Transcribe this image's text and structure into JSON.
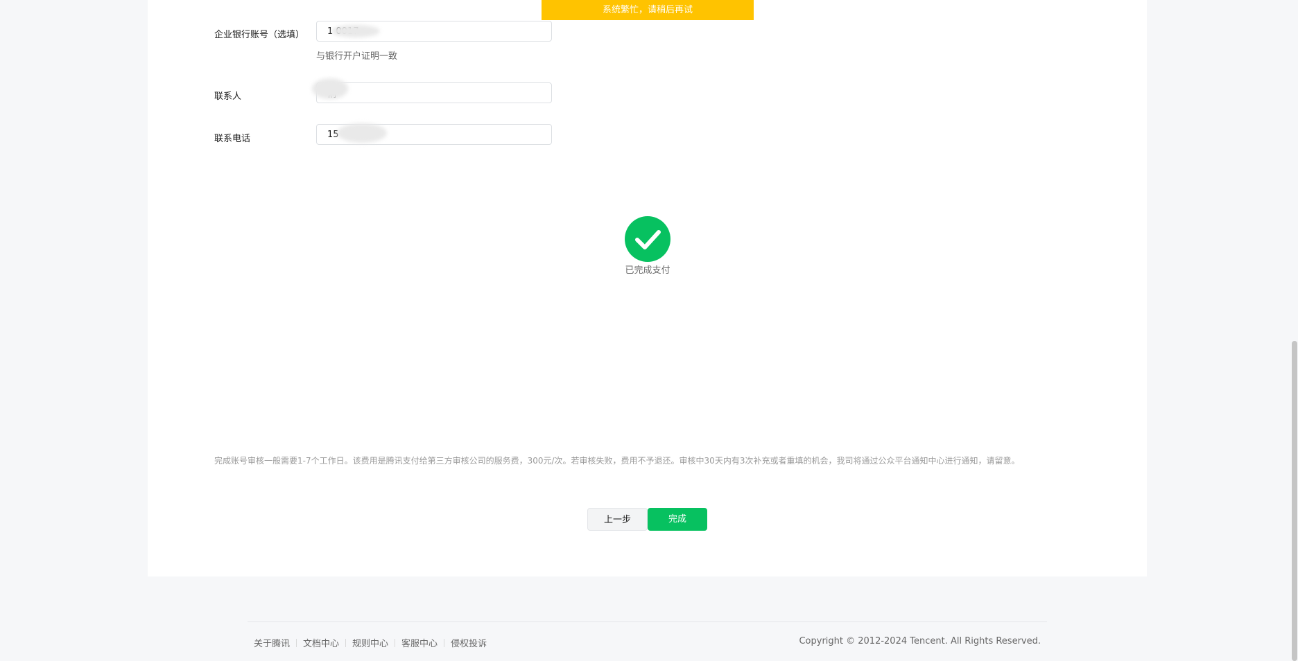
{
  "toast": {
    "message": "系统繁忙，请稍后再试"
  },
  "form": {
    "bank_account": {
      "label": "企业银行账号（选填）",
      "value": "1 0017",
      "hint": "与银行开户证明一致"
    },
    "contact_name": {
      "label": "联系人",
      "value": "俐"
    },
    "contact_phone": {
      "label": "联系电话",
      "value": "15"
    }
  },
  "status": {
    "text": "已完成支付",
    "icon": "check-circle-icon",
    "color": "#07c160"
  },
  "notice": "完成账号审核一般需要1-7个工作日。该费用是腾讯支付给第三方审核公司的服务费，300元/次。若审核失败，费用不予退还。审核中30天内有3次补充或者重填的机会，我司将通过公众平台通知中心进行通知，请留意。",
  "buttons": {
    "prev_label": "上一步",
    "done_label": "完成"
  },
  "footer": {
    "links": [
      "关于腾讯",
      "文档中心",
      "规则中心",
      "客服中心",
      "侵权投诉"
    ],
    "copyright": "Copyright © 2012-2024 Tencent. All Rights Reserved."
  },
  "colors": {
    "accent": "#07c160",
    "toast_bg": "#ffc300"
  }
}
